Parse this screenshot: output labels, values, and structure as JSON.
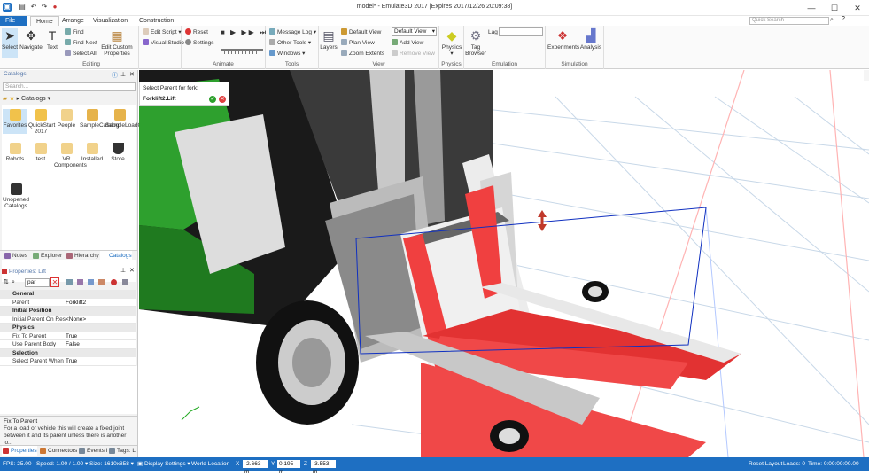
{
  "title": "model* - Emulate3D 2017 [Expires 2017/12/26 20:09:38]",
  "tabs": [
    "File",
    "Home",
    "Arrange",
    "Visualization",
    "Construction"
  ],
  "search_placeholder": "Quick Search",
  "ribbon": {
    "editing": {
      "label": "Editing",
      "select": "Select",
      "navigate": "Navigate",
      "text": "Text",
      "find": "Find",
      "find_next": "Find Next",
      "select_all": "Select All",
      "edit_custom": "Edit Custom Properties"
    },
    "script": {
      "edit_script": "Edit Script",
      "visual_studio": "Visual Studio"
    },
    "animate": {
      "label": "Animate",
      "reset": "Reset",
      "settings": "Settings"
    },
    "tools": {
      "label": "Tools",
      "message_log": "Message Log",
      "other_tools": "Other Tools",
      "windows": "Windows"
    },
    "view": {
      "label": "View",
      "layers": "Layers",
      "default_view": "Default View",
      "plan_view": "Plan View",
      "zoom_extents": "Zoom Extents",
      "view_select": "Default View",
      "add_view": "Add View",
      "remove_view": "Remove View"
    },
    "physics": {
      "label": "Physics",
      "physics": "Physics"
    },
    "emulation": {
      "label": "Emulation",
      "tag_browser": "Tag Browser",
      "lag": "Lag"
    },
    "simulation": {
      "label": "Simulation",
      "experiments": "Experiments",
      "analysis": "Analysis"
    }
  },
  "catalog": {
    "title": "Catalogs",
    "search_placeholder": "Search...",
    "breadcrumb": "Catalogs",
    "items": [
      "Favorites",
      "QuickStart 2017",
      "People",
      "SampleCatalog",
      "SampleLoadCatalog",
      "Robots",
      "test",
      "VR Components",
      "Installed",
      "Store",
      "Unopened Catalogs"
    ],
    "tabs": [
      "Notes",
      "Explorer",
      "Hierarchy",
      "Catalogs"
    ]
  },
  "properties": {
    "title": "Properties: Lift",
    "filter": "par",
    "sections": [
      {
        "name": "General",
        "rows": [
          [
            "Parent",
            "Forklift2"
          ]
        ]
      },
      {
        "name": "Initial Position",
        "rows": [
          [
            "Initial Parent On Rese",
            "<None>"
          ]
        ]
      },
      {
        "name": "Physics",
        "rows": [
          [
            "Fix To Parent",
            "True"
          ],
          [
            "Use Parent Body",
            "False"
          ]
        ]
      },
      {
        "name": "Selection",
        "rows": [
          [
            "Select Parent When P",
            "True"
          ]
        ]
      }
    ],
    "help_title": "Fix To Parent",
    "help_text": "For a load or vehicle this will create a fixed joint between it and its parent unless there is another jo..."
  },
  "select_parent": {
    "prompt": "Select Parent for fork:",
    "value": "Forklift2.Lift"
  },
  "status": {
    "fps": "FPS: 25.00",
    "speed": "Speed: 1.00 / 1.00",
    "size": "Size: 1610x858",
    "display": "Display Settings",
    "world": "World Location",
    "x_label": "X",
    "x": "-2.663 m",
    "y_label": "Y",
    "y": "0.195 m",
    "z_label": "Z",
    "z": "-3.553 m",
    "reset_layout": "Reset Layout",
    "loads": "Loads: 0",
    "time": "Time: 0:00:00:00.00"
  },
  "bottom_tabs": [
    "Properties",
    "Connectors",
    "Events I",
    "Tags: L"
  ]
}
